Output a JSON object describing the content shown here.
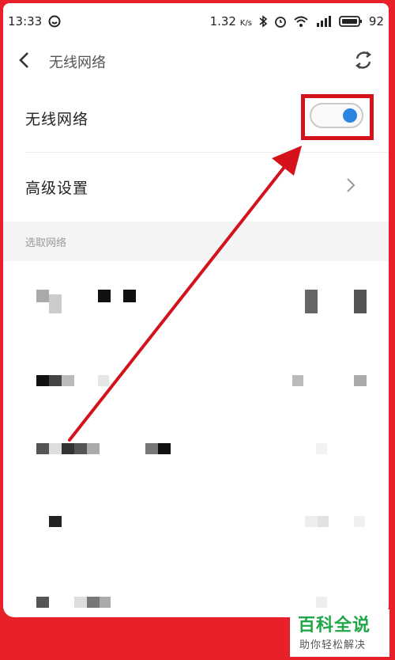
{
  "status_bar": {
    "time": "13:33",
    "network_speed": "1.32",
    "speed_unit": "K/s",
    "battery": "92"
  },
  "header": {
    "title": "无线网络"
  },
  "settings": {
    "wifi_label": "无线网络",
    "wifi_enabled": true,
    "advanced_label": "高级设置"
  },
  "networks": {
    "section_label": "选取网络"
  },
  "watermark": {
    "title": "百科全说",
    "subtitle": "助你轻松解决"
  },
  "colors": {
    "toggle_on": "#2b84e0",
    "highlight": "#d4121c",
    "border": "#e8202a",
    "watermark_green": "#1fa74a"
  }
}
